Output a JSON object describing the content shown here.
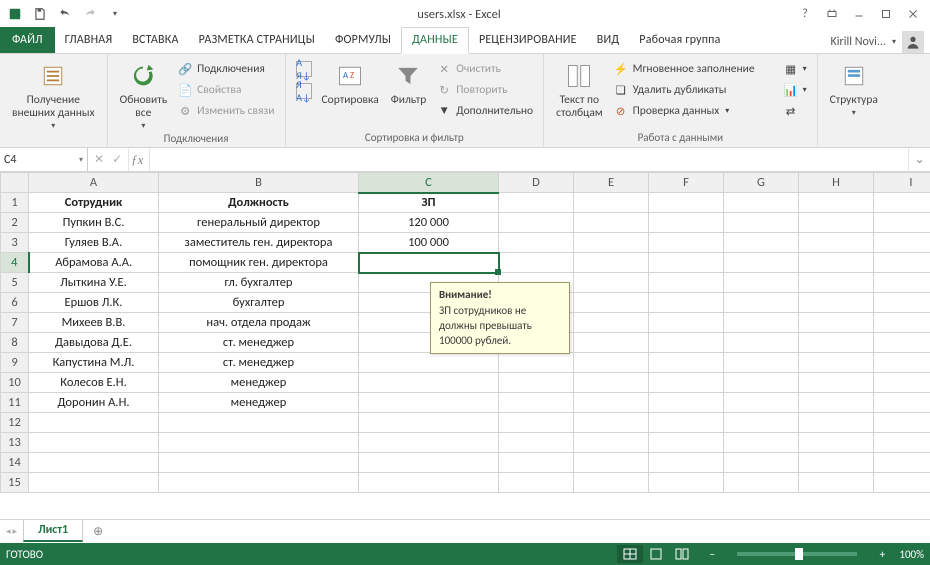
{
  "window": {
    "title": "users.xlsx - Excel"
  },
  "tabs": {
    "file": "ФАЙЛ",
    "items": [
      "ГЛАВНАЯ",
      "ВСТАВКА",
      "РАЗМЕТКА СТРАНИЦЫ",
      "ФОРМУЛЫ",
      "ДАННЫЕ",
      "РЕЦЕНЗИРОВАНИЕ",
      "ВИД",
      "Рабочая группа"
    ],
    "active": "ДАННЫЕ",
    "user": "Kirill Novi..."
  },
  "ribbon": {
    "getdata": {
      "big": "Получение\nвнешних данных"
    },
    "connections": {
      "refresh": "Обновить\nвсе",
      "connections": "Подключения",
      "properties": "Свойства",
      "editlinks": "Изменить связи",
      "label": "Подключения"
    },
    "sort": {
      "sort": "Сортировка",
      "filter": "Фильтр",
      "clear": "Очистить",
      "reapply": "Повторить",
      "advanced": "Дополнительно",
      "label": "Сортировка и фильтр"
    },
    "datatools": {
      "t2c": "Текст по\nстолбцам",
      "flash": "Мгновенное заполнение",
      "dup": "Удалить дубликаты",
      "valid": "Проверка данных",
      "label": "Работа с данными"
    },
    "outline": {
      "big": "Структура"
    }
  },
  "fxbar": {
    "cell": "C4",
    "formula": ""
  },
  "grid": {
    "cols": [
      "A",
      "B",
      "C",
      "D",
      "E",
      "F",
      "G",
      "H",
      "I"
    ],
    "activeCol": "C",
    "activeRow": "4",
    "headers": {
      "A": "Сотрудник",
      "B": "Должность",
      "C": "ЗП"
    },
    "rows": [
      {
        "n": "2",
        "A": "Пупкин В.С.",
        "B": "генеральный директор",
        "C": "120 000"
      },
      {
        "n": "3",
        "A": "Гуляев В.А.",
        "B": "заместитель ген. директора",
        "C": "100 000"
      },
      {
        "n": "4",
        "A": "Абрамова А.А.",
        "B": "помощник ген. директора",
        "C": ""
      },
      {
        "n": "5",
        "A": "Лыткина У.Е.",
        "B": "гл. бухгалтер",
        "C": ""
      },
      {
        "n": "6",
        "A": "Ершов Л.К.",
        "B": "бухгалтер",
        "C": ""
      },
      {
        "n": "7",
        "A": "Михеев В.В.",
        "B": "нач. отдела продаж",
        "C": ""
      },
      {
        "n": "8",
        "A": "Давыдова Д.Е.",
        "B": "ст. менеджер",
        "C": ""
      },
      {
        "n": "9",
        "A": "Капустина М.Л.",
        "B": "ст. менеджер",
        "C": ""
      },
      {
        "n": "10",
        "A": "Колесов Е.Н.",
        "B": "менеджер",
        "C": ""
      },
      {
        "n": "11",
        "A": "Доронин А.Н.",
        "B": "менеджер",
        "C": ""
      },
      {
        "n": "12",
        "A": "",
        "B": "",
        "C": ""
      },
      {
        "n": "13",
        "A": "",
        "B": "",
        "C": ""
      },
      {
        "n": "14",
        "A": "",
        "B": "",
        "C": ""
      },
      {
        "n": "15",
        "A": "",
        "B": "",
        "C": ""
      }
    ]
  },
  "tooltip": {
    "title": "Внимание!",
    "body": "ЗП сотрудников не должны превышать 100000 рублей."
  },
  "sheets": {
    "active": "Лист1"
  },
  "status": {
    "ready": "ГОТОВО",
    "zoom": "100%"
  }
}
